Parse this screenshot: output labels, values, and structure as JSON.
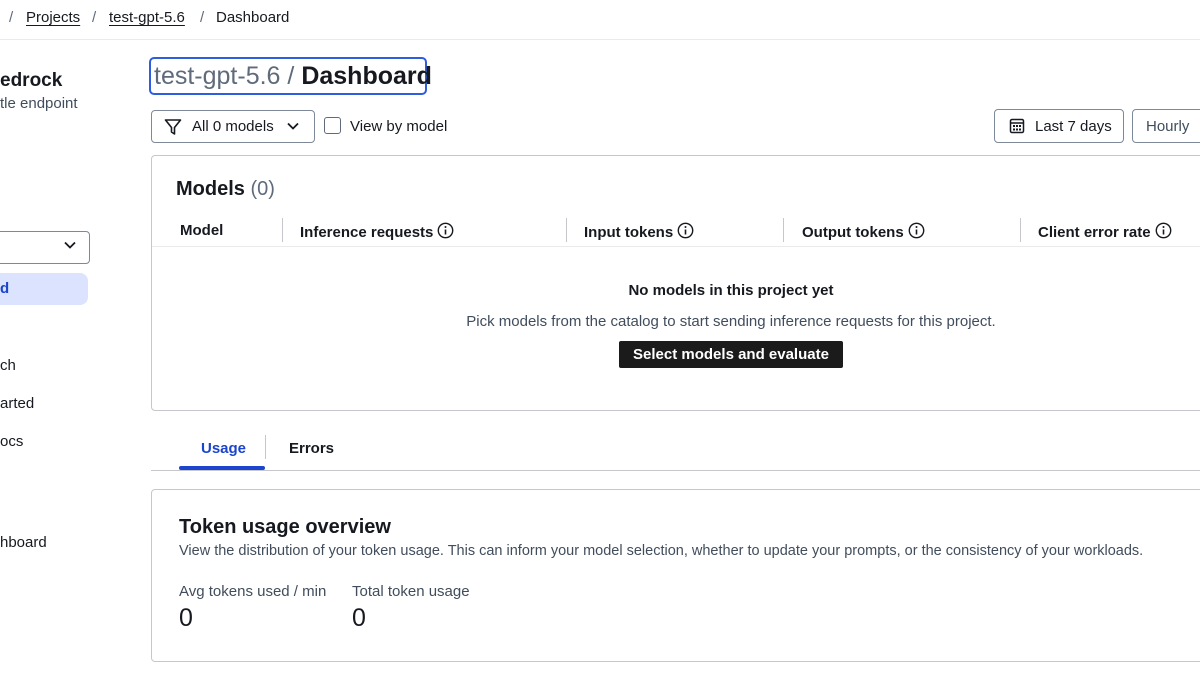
{
  "breadcrumb": {
    "items": [
      "Projects",
      "test-gpt-5.6",
      "Dashboard"
    ],
    "separator": "/"
  },
  "sidebar": {
    "title": "edrock",
    "subtitle": "tle endpoint",
    "active_item": "d",
    "items": [
      "ch",
      "arted",
      "ocs",
      "hboard"
    ]
  },
  "header": {
    "project": "test-gpt-5.6",
    "slash": "/",
    "page": "Dashboard"
  },
  "toolbar": {
    "filter_label": "All 0 models",
    "view_by_model_label": "View by model",
    "date_range_label": "Last 7 days",
    "granularity_label": "Hourly"
  },
  "models": {
    "title": "Models",
    "count": "(0)",
    "columns": [
      "Model",
      "Inference requests",
      "Input tokens",
      "Output tokens",
      "Client error rate"
    ],
    "empty_title": "No models in this project yet",
    "empty_desc": "Pick models from the catalog to start sending inference requests for this project.",
    "cta": "Select models and evaluate"
  },
  "tabs": [
    "Usage",
    "Errors"
  ],
  "usage": {
    "title": "Token usage overview",
    "description": "View the distribution of your token usage. This can inform your model selection, whether to update your prompts, or the consistency of your workloads.",
    "metrics": [
      {
        "label": "Avg tokens used / min",
        "value": "0"
      },
      {
        "label": "Total token usage",
        "value": "0"
      }
    ]
  },
  "colors": {
    "accent": "#1c44cc",
    "active_bg": "#dbe3fe",
    "primary_button": "#1b1b1b",
    "border": "#c6c6cd"
  }
}
